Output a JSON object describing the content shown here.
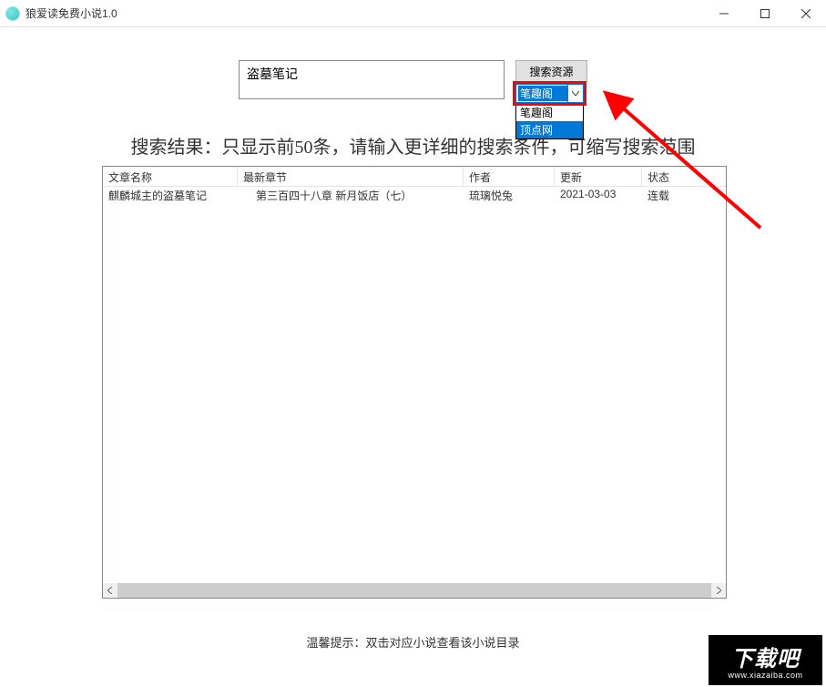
{
  "window": {
    "title": "狼爱读免费小说1.0"
  },
  "search": {
    "value": "盗墓笔记",
    "button_label": "搜索资源"
  },
  "dropdown": {
    "selected": "笔趣阁",
    "options": [
      "笔趣阁",
      "顶点网"
    ]
  },
  "hints": {
    "result": "搜索结果：只显示前50条，请输入更详细的搜索条件，可缩写搜索范围",
    "bottom": "温馨提示：双击对应小说查看该小说目录"
  },
  "table": {
    "headers": {
      "title": "文章名称",
      "chapter": "最新章节",
      "author": "作者",
      "update": "更新",
      "status": "状态"
    },
    "rows": [
      {
        "title": "麒麟城主的盗墓笔记",
        "chapter": "第三百四十八章 新月饭店（七）",
        "author": "琉璃悦兔",
        "update": "2021-03-03",
        "status": "连载"
      }
    ]
  },
  "watermark": {
    "big": "下载吧",
    "small": "www.xiazaiba.com"
  }
}
